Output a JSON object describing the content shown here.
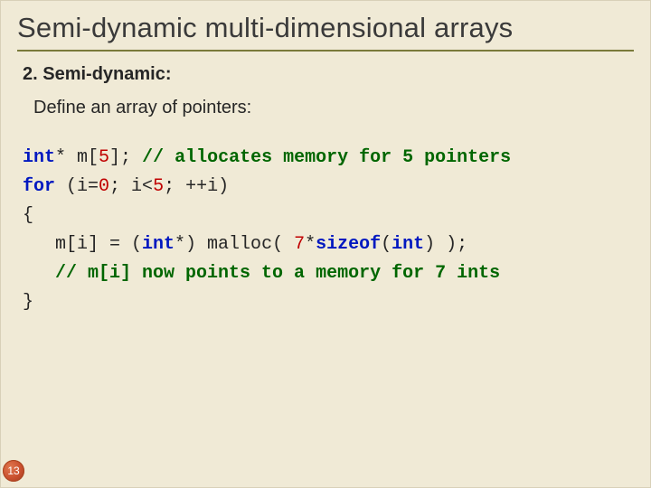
{
  "slide": {
    "title": "Semi-dynamic multi-dimensional arrays",
    "subtitle": "2. Semi-dynamic:",
    "body": "Define an array of pointers:",
    "page_number": "13"
  },
  "code": {
    "l1": {
      "kw1": "int",
      "t1": "* m[",
      "n1": "5",
      "t2": "]; ",
      "cm": "// allocates memory for 5 pointers"
    },
    "l2": {
      "kw1": "for",
      "t1": " (i=",
      "n1": "0",
      "t2": "; i<",
      "n2": "5",
      "t3": "; ++i)"
    },
    "l3": {
      "t1": "{"
    },
    "l4": {
      "t1": "   m[i] = (",
      "kw1": "int",
      "t2": "*) malloc( ",
      "n1": "7",
      "t3": "*",
      "kw2": "sizeof",
      "t4": "(",
      "kw3": "int",
      "t5": ") );"
    },
    "l5": {
      "t1": "   ",
      "cm": "// m[i] now points to a memory for 7 ints"
    },
    "l6": {
      "t1": "}"
    }
  }
}
